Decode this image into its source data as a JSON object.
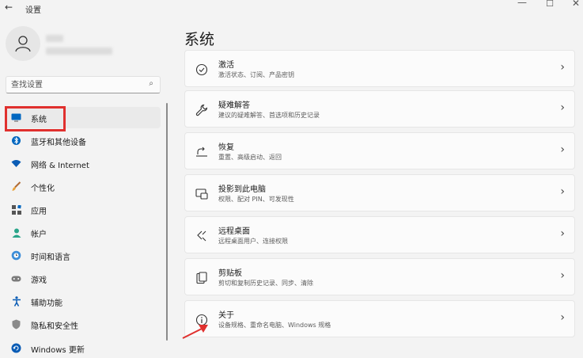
{
  "window": {
    "title": "设置",
    "back": "←",
    "minimize": "—",
    "maximize": "☐",
    "close": "✕"
  },
  "search": {
    "placeholder": "查找设置"
  },
  "sidebar": {
    "items": [
      {
        "label": "系统",
        "icon": "display-icon"
      },
      {
        "label": "蓝牙和其他设备",
        "icon": "bluetooth-icon"
      },
      {
        "label": "网络 & Internet",
        "icon": "wifi-icon"
      },
      {
        "label": "个性化",
        "icon": "brush-icon"
      },
      {
        "label": "应用",
        "icon": "apps-icon"
      },
      {
        "label": "帐户",
        "icon": "account-icon"
      },
      {
        "label": "时间和语言",
        "icon": "globe-clock-icon"
      },
      {
        "label": "游戏",
        "icon": "gamepad-icon"
      },
      {
        "label": "辅助功能",
        "icon": "accessibility-icon"
      },
      {
        "label": "隐私和安全性",
        "icon": "shield-icon"
      },
      {
        "label": "Windows 更新",
        "icon": "update-icon"
      }
    ],
    "selected": "系统"
  },
  "main": {
    "title": "系统",
    "cards": [
      {
        "title": "激活",
        "sub": "激活状态、订阅、产品密钥",
        "icon": "check-circle-icon"
      },
      {
        "title": "疑难解答",
        "sub": "建议的疑难解答、首选项和历史记录",
        "icon": "wrench-icon"
      },
      {
        "title": "恢复",
        "sub": "重置、高级启动、返回",
        "icon": "recovery-icon"
      },
      {
        "title": "投影到此电脑",
        "sub": "权限、配对 PIN、可发现性",
        "icon": "projector-icon"
      },
      {
        "title": "远程桌面",
        "sub": "远程桌面用户、连接权限",
        "icon": "remote-desktop-icon"
      },
      {
        "title": "剪贴板",
        "sub": "剪切和复制历史记录、同步、清除",
        "icon": "clipboard-icon"
      },
      {
        "title": "关于",
        "sub": "设备规格、重命名电脑、Windows 规格",
        "icon": "info-icon"
      }
    ]
  },
  "colors": {
    "accent": "#0067c0",
    "highlight": "#e0302e"
  }
}
